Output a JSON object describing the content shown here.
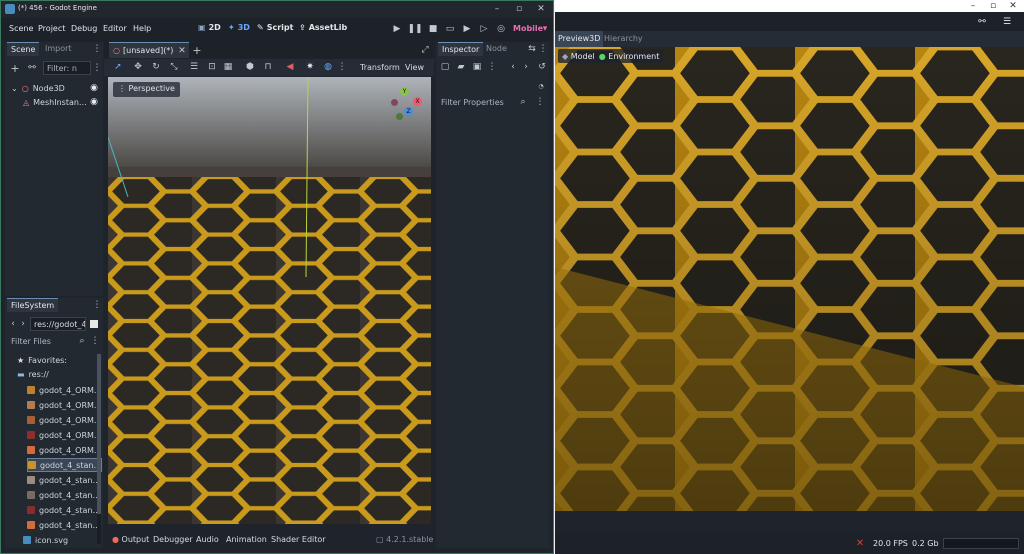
{
  "window": {
    "title": "(*) 456 - Godot Engine"
  },
  "menu": [
    "Scene",
    "Project",
    "Debug",
    "Editor",
    "Help"
  ],
  "workspaces": {
    "b2d": "2D",
    "b3d": "3D",
    "script": "Script",
    "assetlib": "AssetLib"
  },
  "renderer": "Mobile",
  "scene_dock": {
    "tabs": [
      "Scene",
      "Import"
    ],
    "filter_placeholder": "Filter: n",
    "nodes": [
      "Node3D",
      "MeshInstan…"
    ]
  },
  "filesystem": {
    "tab": "FileSystem",
    "path": "res://godot_4_",
    "filter_placeholder": "Filter Files",
    "favorites": "Favorites:",
    "root": "res://",
    "files": [
      {
        "name": "godot_4_ORM…",
        "color": "#c0802a"
      },
      {
        "name": "godot_4_ORM…",
        "color": "#b47a52"
      },
      {
        "name": "godot_4_ORM…",
        "color": "#a85f36"
      },
      {
        "name": "godot_4_ORM…",
        "color": "#8b2f2f"
      },
      {
        "name": "godot_4_ORM…",
        "color": "#d76a3c"
      },
      {
        "name": "godot_4_stan…",
        "color": "#c8922e"
      },
      {
        "name": "godot_4_stan…",
        "color": "#9e8b7b"
      },
      {
        "name": "godot_4_stan…",
        "color": "#7b6a62"
      },
      {
        "name": "godot_4_stan…",
        "color": "#8b2c2c"
      },
      {
        "name": "godot_4_stan…",
        "color": "#d06d3a"
      }
    ],
    "selected_index": 5,
    "last_file": "icon.svg"
  },
  "editor_tab": "[unsaved](*)",
  "toolbar": {
    "transform": "Transform",
    "view": "View"
  },
  "viewport": {
    "label": "Perspective"
  },
  "inspector": {
    "tabs": [
      "Inspector",
      "Node"
    ],
    "filter_placeholder": "Filter Properties"
  },
  "bottom_tabs": [
    "Output",
    "Debugger",
    "Audio",
    "Animation",
    "Shader Editor"
  ],
  "version": "4.2.1.stable",
  "preview": {
    "tabs": [
      "Preview3D",
      "Hierarchy"
    ],
    "subtabs": [
      "Model",
      "Environment"
    ],
    "fps": "20.0 FPS",
    "memory": "0.2 Gb"
  },
  "colors": {
    "accent": "#4a8fd9",
    "gold": "#c8961c",
    "bg": "#232931"
  }
}
